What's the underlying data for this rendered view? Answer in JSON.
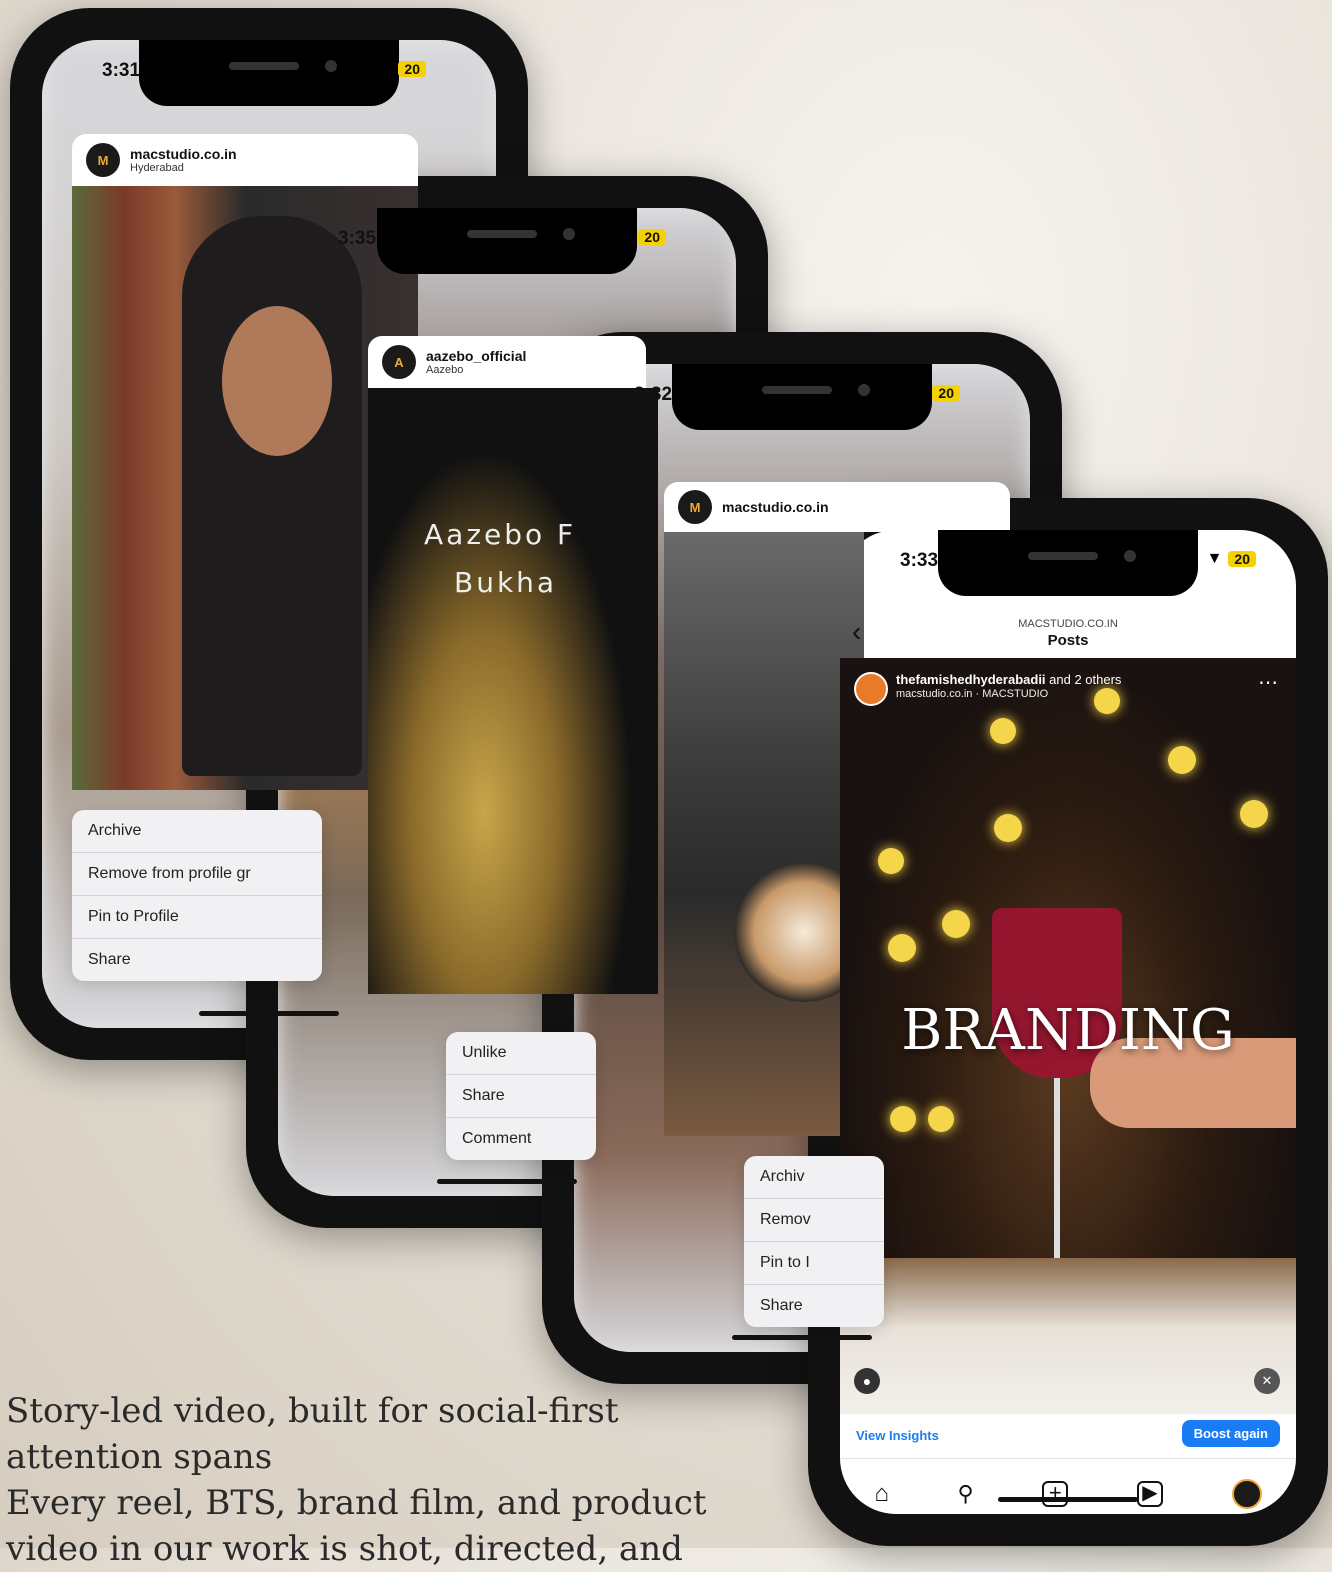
{
  "phone1": {
    "time": "3:31",
    "battery": "20",
    "account": "macstudio.co.in",
    "location": "Hyderabad",
    "menu": [
      "Archive",
      "Remove from profile gr",
      "Pin to Profile",
      "Share"
    ]
  },
  "phone2": {
    "time": "3:35",
    "battery": "20",
    "account": "aazebo_official",
    "location": "Aazebo",
    "overlay_line1": "Aazebo F",
    "overlay_line2": "Bukha",
    "menu": [
      "Unlike",
      "Share",
      "Comment"
    ]
  },
  "phone3": {
    "time": "3:32",
    "battery": "20",
    "account": "macstudio.co.in",
    "menu": [
      "Archiv",
      "Remov",
      "Pin to I",
      "Share"
    ]
  },
  "phone4": {
    "time": "3:33",
    "battery": "20",
    "header_small": "MACSTUDIO.CO.IN",
    "header_title": "Posts",
    "post_user": "thefamishedhyderabadii",
    "post_user_suffix": " and 2 others",
    "post_sub": "macstudio.co.in · MACSTUDIO",
    "overlay_text": "BRANDING",
    "view_insights": "View Insights",
    "boost": "Boost again",
    "nav_icons": [
      "home-icon",
      "search-icon",
      "create-icon",
      "reels-icon",
      "profile-icon"
    ]
  },
  "caption": {
    "line1": "Story-led video, built for social-first",
    "line2": "attention spans",
    "line3": "Every reel, BTS, brand film, and product",
    "line4": "video in our work is shot, directed, and"
  },
  "colors": {
    "accent_blue": "#1a7cf5",
    "battery": "#f5d100",
    "wine": "#9a1530"
  }
}
